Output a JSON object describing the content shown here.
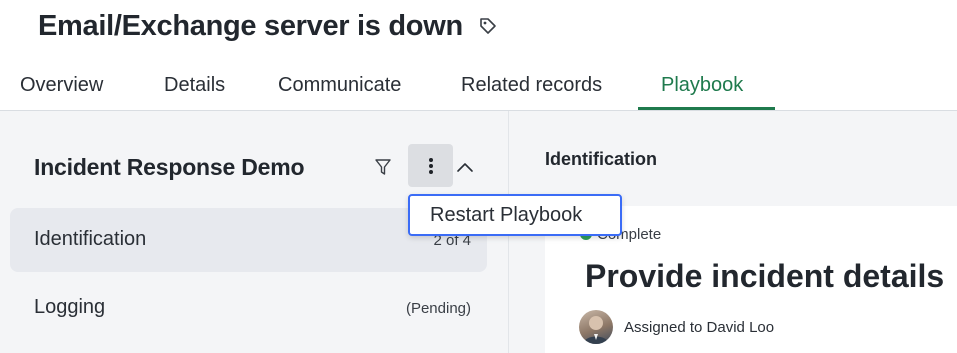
{
  "header": {
    "title": "Email/Exchange server is down",
    "tag_icon": "tag-icon"
  },
  "tabs": [
    {
      "label": "Overview",
      "active": false
    },
    {
      "label": "Details",
      "active": false
    },
    {
      "label": "Communicate",
      "active": false
    },
    {
      "label": "Related records",
      "active": false
    },
    {
      "label": "Playbook",
      "active": true
    }
  ],
  "playbook": {
    "title": "Incident Response Demo",
    "filter_icon": "filter-icon",
    "more_icon": "more-vertical-icon",
    "collapse_icon": "chevron-up-icon",
    "steps": [
      {
        "label": "Identification",
        "meta": "2 of 4",
        "selected": true
      },
      {
        "label": "Logging",
        "meta": "(Pending)",
        "selected": false
      }
    ]
  },
  "menu": {
    "items": [
      "Restart Playbook"
    ]
  },
  "detail": {
    "section_title": "Identification",
    "status": "Complete",
    "task_title": "Provide incident details",
    "assigned_text": "Assigned to David Loo"
  },
  "colors": {
    "accent": "#1f7a4d",
    "status_complete": "#2e9e5b",
    "menu_border": "#3b6cf6"
  }
}
